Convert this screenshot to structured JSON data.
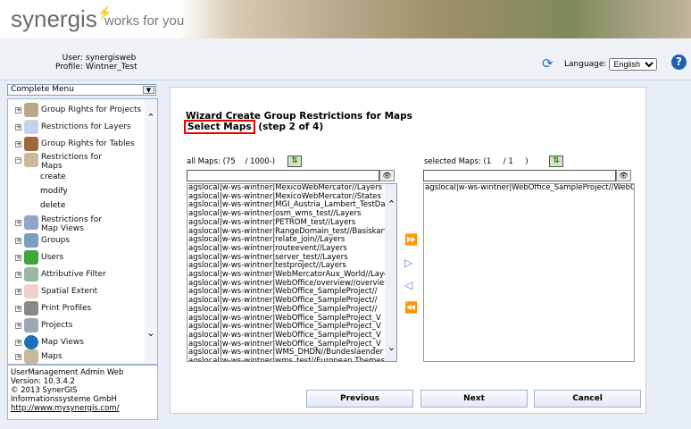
{
  "header": {
    "logo": "synergis",
    "tagline": "works for you"
  },
  "user": {
    "user_label": "User:",
    "user": "synergisweb",
    "profile_label": "Profile:",
    "profile": "Wintner_Test"
  },
  "language": {
    "label": "Language:",
    "value": "English"
  },
  "sidebar": {
    "menu_select": "Complete Menu",
    "items": [
      {
        "label": "Group Rights for Projects"
      },
      {
        "label": "Restrictions for Layers"
      },
      {
        "label": "Group Rights for Tables"
      },
      {
        "label": "Restrictions for Maps",
        "expanded": true,
        "children": [
          "create",
          "modify",
          "delete"
        ]
      },
      {
        "label": "Restrictions for Map Views"
      },
      {
        "label": "Groups"
      },
      {
        "label": "Users"
      },
      {
        "label": "Attributive Filter"
      },
      {
        "label": "Spatial Extent"
      },
      {
        "label": "Print Profiles"
      },
      {
        "label": "Projects"
      },
      {
        "label": "Map Views"
      },
      {
        "label": "Maps"
      }
    ]
  },
  "about": {
    "line1": "UserManagement Admin Web",
    "line2": "Version: 10.3.4.2",
    "line3": "© 2013 SynerGIS",
    "line4": "Informationssysteme GmbH",
    "link": "http://www.mysynergis.com/"
  },
  "wizard": {
    "title": "Wizard Create Group Restrictions for Maps",
    "step_title": "Select Maps",
    "step_info": "(step 2 of 4)"
  },
  "all_maps": {
    "label": "all Maps: (75    / 1000-)",
    "filter": "",
    "items": [
      "agslocal|w-ws-wintner|MexicoWebMercator//Layers",
      "agslocal|w-ws-wintner|MexicoWebMercator//States",
      "agslocal|w-ws-wintner|MGI_Austria_Lambert_TestData",
      "agslocal|w-ws-wintner|osm_wms_test//Layers",
      "agslocal|w-ws-wintner|PETROM_test//Layers",
      "agslocal|w-ws-wintner|RangeDomain_test//Basiskarte",
      "agslocal|w-ws-wintner|relate_join//Layers",
      "agslocal|w-ws-wintner|routeevent//Layers",
      "agslocal|w-ws-wintner|server_test//Layers",
      "agslocal|w-ws-wintner|testproject//Layers",
      "agslocal|w-ws-wintner|WebMercatorAux_World//Layers",
      "agslocal|w-ws-wintner|WebOffice/overview//overview",
      "agslocal|w-ws-wintner|WebOffice_SampleProject//",
      "agslocal|w-ws-wintner|WebOffice_SampleProject//",
      "agslocal|w-ws-wintner|WebOffice_SampleProject//",
      "agslocal|w-ws-wintner|WebOffice_SampleProject_V",
      "agslocal|w-ws-wintner|WebOffice_SampleProject_V",
      "agslocal|w-ws-wintner|WebOffice_SampleProject_V",
      "agslocal|w-ws-wintner|WebOffice_SampleProject_V",
      "agslocal|w-ws-wintner|WMS_DHDN//Bundeslaender",
      "agslocal|w-ws-wintner|wms_test//European Themes"
    ]
  },
  "selected_maps": {
    "label": "selected Maps: (1     / 1     )",
    "filter": "",
    "items": [
      "agslocal|w-ws-wintner|WebOffice_SampleProject//WebOffice"
    ]
  },
  "buttons": {
    "previous": "Previous",
    "next": "Next",
    "cancel": "Cancel"
  }
}
